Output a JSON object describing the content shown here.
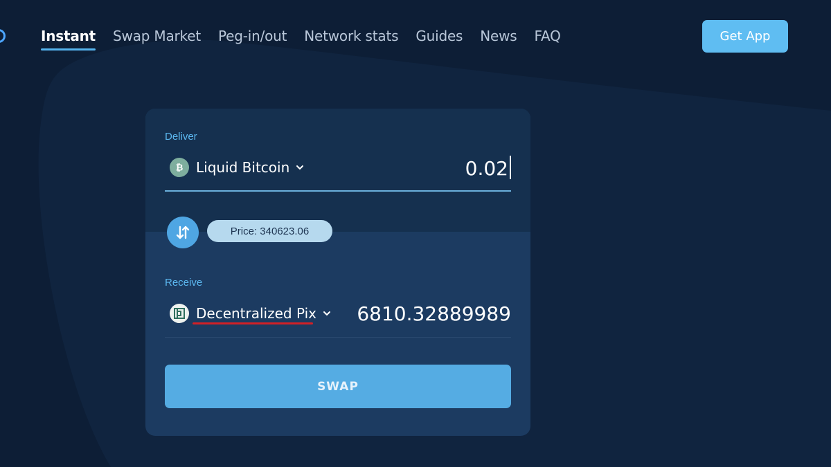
{
  "nav": {
    "links": [
      {
        "label": "Instant",
        "active": true
      },
      {
        "label": "Swap Market",
        "active": false
      },
      {
        "label": "Peg-in/out",
        "active": false
      },
      {
        "label": "Network stats",
        "active": false
      },
      {
        "label": "Guides",
        "active": false
      },
      {
        "label": "News",
        "active": false
      },
      {
        "label": "FAQ",
        "active": false
      }
    ],
    "get_app_label": "Get App"
  },
  "swap": {
    "deliver": {
      "label": "Deliver",
      "asset": "Liquid Bitcoin",
      "asset_icon": "bitcoin-icon",
      "amount": "0.02"
    },
    "price_label": "Price: 340623.06",
    "receive": {
      "label": "Receive",
      "asset": "Decentralized Pix",
      "asset_icon": "depix-icon",
      "amount": "6810.32889989"
    },
    "swap_button_label": "SWAP"
  },
  "colors": {
    "background": "#0d1e36",
    "card": "#1c3b61",
    "card_top": "#15304f",
    "accent": "#55ace3",
    "label_blue": "#5cb8f0",
    "annotation_red": "#d32026"
  }
}
